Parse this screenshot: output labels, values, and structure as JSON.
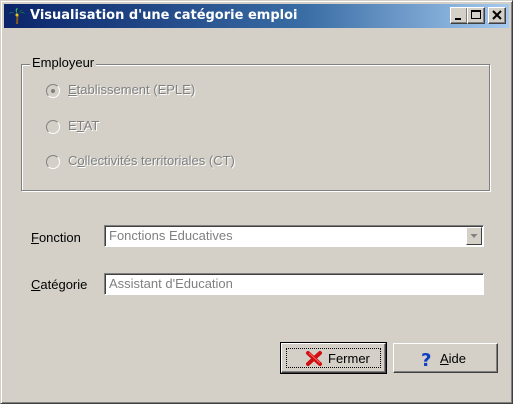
{
  "window": {
    "title": "Visualisation d'une catégorie emploi",
    "icons": {
      "app": "palm-tree-icon",
      "minimize": "minimize-icon",
      "maximize": "maximize-icon",
      "close": "close-icon"
    }
  },
  "employeur": {
    "legend": "Employeur",
    "options": [
      {
        "label": "Etablissement (EPLE)",
        "selected": true,
        "enabled": false
      },
      {
        "label": "ETAT",
        "selected": false,
        "enabled": false
      },
      {
        "label": "Collectivités territoriales (CT)",
        "selected": false,
        "enabled": false
      }
    ]
  },
  "fonction": {
    "label": "Fonction",
    "value": "Fonctions Educatives",
    "icon": "chevron-down-icon"
  },
  "categorie": {
    "label": "Catégorie",
    "value": "Assistant d'Education"
  },
  "buttons": {
    "fermer": {
      "label": "Fermer",
      "icon": "red-x-icon"
    },
    "aide": {
      "label": "Aide",
      "icon": "question-mark-icon"
    }
  },
  "colors": {
    "titlebar_start": "#0a246a",
    "titlebar_end": "#a6caf0",
    "face": "#d4d0c8"
  }
}
